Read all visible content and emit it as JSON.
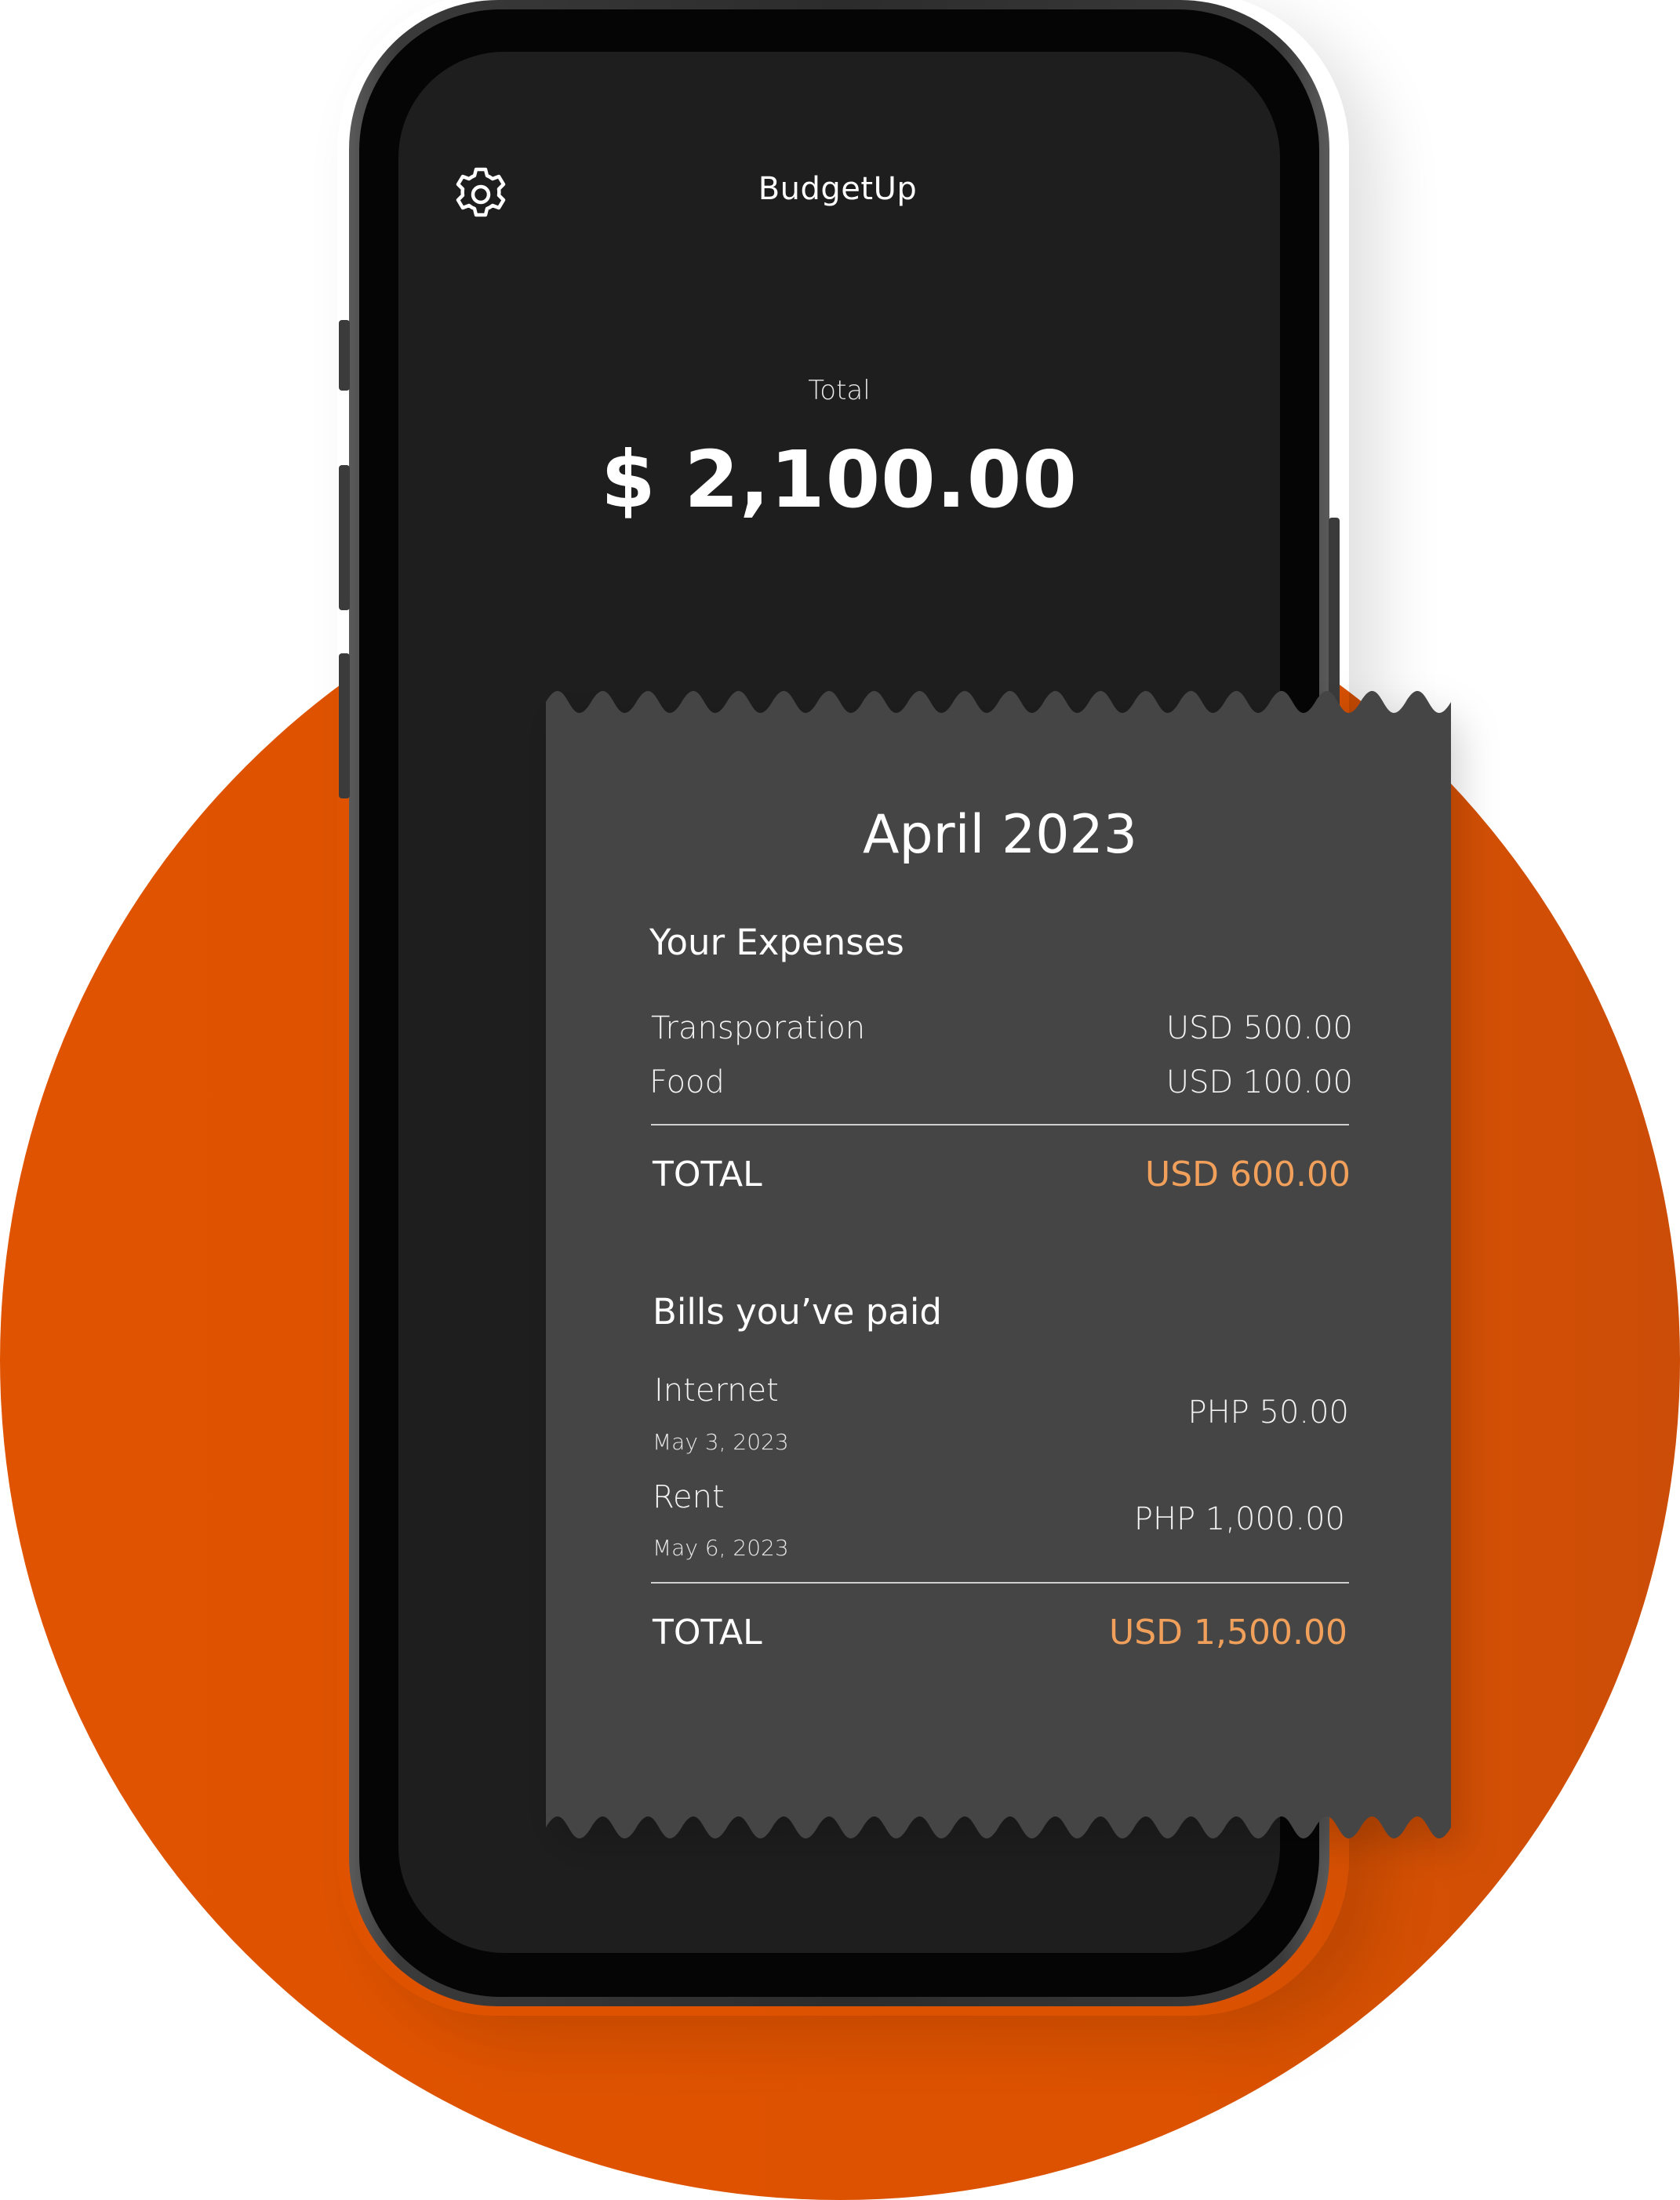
{
  "app": {
    "title": "BudgetUp"
  },
  "header": {
    "total_label": "Total",
    "total_amount": "$ 2,100.00"
  },
  "receipt": {
    "month": "April 2023",
    "expenses": {
      "title": "Your Expenses",
      "items": [
        {
          "label": "Transporation",
          "value": "USD 500.00"
        },
        {
          "label": "Food",
          "value": "USD 100.00"
        }
      ],
      "total_label": "TOTAL",
      "total_value": "USD 600.00"
    },
    "bills": {
      "title": "Bills you’ve paid",
      "items": [
        {
          "label": "Internet",
          "date": "May 3, 2023",
          "value": "PHP 50.00"
        },
        {
          "label": "Rent",
          "date": "May 6, 2023",
          "value": "PHP 1,000.00"
        }
      ],
      "total_label": "TOTAL",
      "total_value": "USD 1,500.00"
    }
  },
  "icons": {
    "settings": "gear-icon"
  },
  "colors": {
    "accent": "#f0a05a",
    "background_circle": "#dd5200",
    "screen": "#1e1e1e",
    "receipt": "#444444"
  }
}
